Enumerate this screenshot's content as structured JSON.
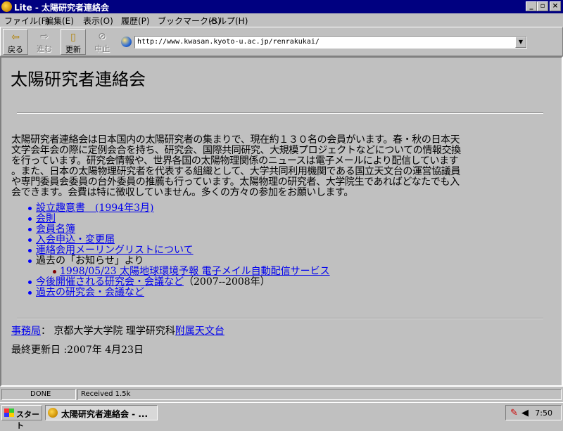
{
  "window": {
    "title": "Lite - 太陽研究者連絡会"
  },
  "menu": [
    "ファイル(F)",
    "編集(E)",
    "表示(O)",
    "履歴(P)",
    "ブックマーク(B)",
    "ヘルプ(H)"
  ],
  "toolbar": {
    "back": "戻る",
    "forward": "進む",
    "reload": "更新",
    "stop": "中止"
  },
  "address": {
    "url": "http://www.kwasan.kyoto-u.ac.jp/renrakukai/"
  },
  "page": {
    "title": "太陽研究者連絡会",
    "intro_lines": [
      "太陽研究者連絡会は日本国内の太陽研究者の集まりで、現在約１３０名の会員がいます。春・秋の日本天",
      "文学会年会の際に定例会合を持ち、研究会、国際共同研究、大規模プロジェクトなどについての情報交換",
      "を行っています。研究会情報や、世界各国の太陽物理関係のニュースは電子メールにより配信しています",
      "。また、日本の太陽物理研究者を代表する組織として、大学共同利用機関である国立天文台の運営協議員",
      "や専門委員会委員の台外委員の推薦も行っています。太陽物理の研究者、大学院生であればどなたでも入",
      "会できます。会費は特に徴収していません。多くの方々の参加をお願いします。"
    ],
    "links": [
      "設立趣意書　(1994年3月)",
      "会則",
      "会員名簿",
      "入会申込・変更届",
      "連絡会用メーリングリストについて"
    ],
    "past_news": {
      "label": "過去の「お知らせ」より",
      "item": "1998/05/23 太陽地球環境予報 電子メイル自動配信サービス"
    },
    "upcoming": {
      "link": "今後開催される研究会・会議など",
      "note": "（2007--2008年）"
    },
    "past_meetings": "過去の研究会・会議など",
    "footer": {
      "office_link": "事務局",
      "office_sep": "：  京都大学大学院 理学研究科",
      "observatory_link": "附属天文台",
      "updated": "最終更新日 :2007年 4月23日"
    }
  },
  "status": {
    "state": "DONE",
    "received": "Received  1.5k"
  },
  "taskbar": {
    "start": "スタート",
    "task": "太陽研究者連絡会 - ...",
    "clock": "7:50"
  }
}
